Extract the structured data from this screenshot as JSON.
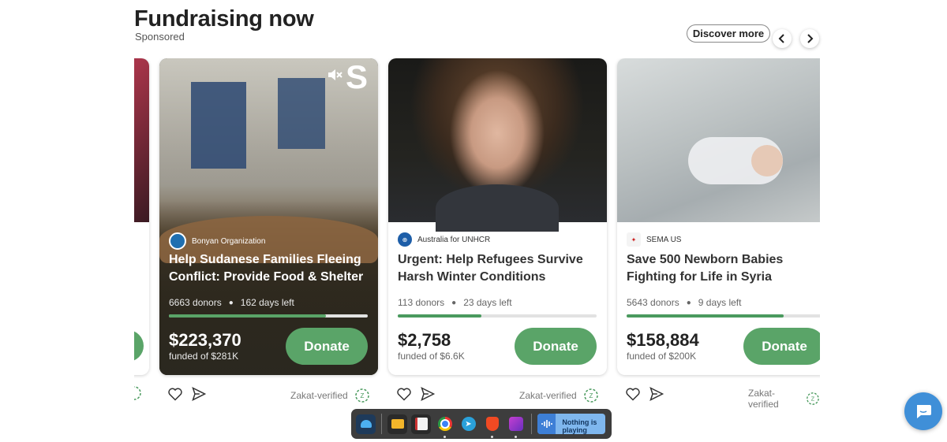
{
  "header": {
    "title": "Fundraising now",
    "subtitle": "Sponsored",
    "discover_label": "Discover more",
    "prev_icon": "chevron-left-icon",
    "next_icon": "chevron-right-icon"
  },
  "cards": [
    {
      "org": "Bonyan Organization",
      "title": "Help Sudanese Families Fleeing Conflict: Provide Food & Shelter",
      "donors": "6663 donors",
      "days_left": "162 days left",
      "progress": 0.79,
      "amount": "$223,370",
      "funded": "funded of $281K",
      "donate_label": "Donate",
      "zakat_label": "Zakat-verified",
      "image_text": "S",
      "overlay_icon": "mute-icon"
    },
    {
      "org": "Australia for UNHCR",
      "title": "Urgent: Help Refugees Survive Harsh Winter Conditions",
      "donors": "113 donors",
      "days_left": "23 days left",
      "progress": 0.42,
      "amount": "$2,758",
      "funded": "funded of $6.6K",
      "donate_label": "Donate",
      "zakat_label": "Zakat-verified"
    },
    {
      "org": "SEMA US",
      "title": "Save 500 Newborn Babies Fighting for Life in Syria",
      "donors": "5643 donors",
      "days_left": "9 days left",
      "progress": 0.79,
      "amount": "$158,884",
      "funded": "funded of $200K",
      "donate_label": "Donate",
      "zakat_label": "Zakat-verified"
    }
  ],
  "dock": {
    "apps": [
      "finder-icon",
      "files-icon",
      "editor-icon",
      "chrome-icon",
      "telegram-icon",
      "brave-icon",
      "notes-icon"
    ],
    "player_text": "Nothing is playing"
  },
  "colors": {
    "accent_green": "#5aa468",
    "progress_green": "#4a9a5e",
    "chat_blue": "#3f8fd8"
  }
}
